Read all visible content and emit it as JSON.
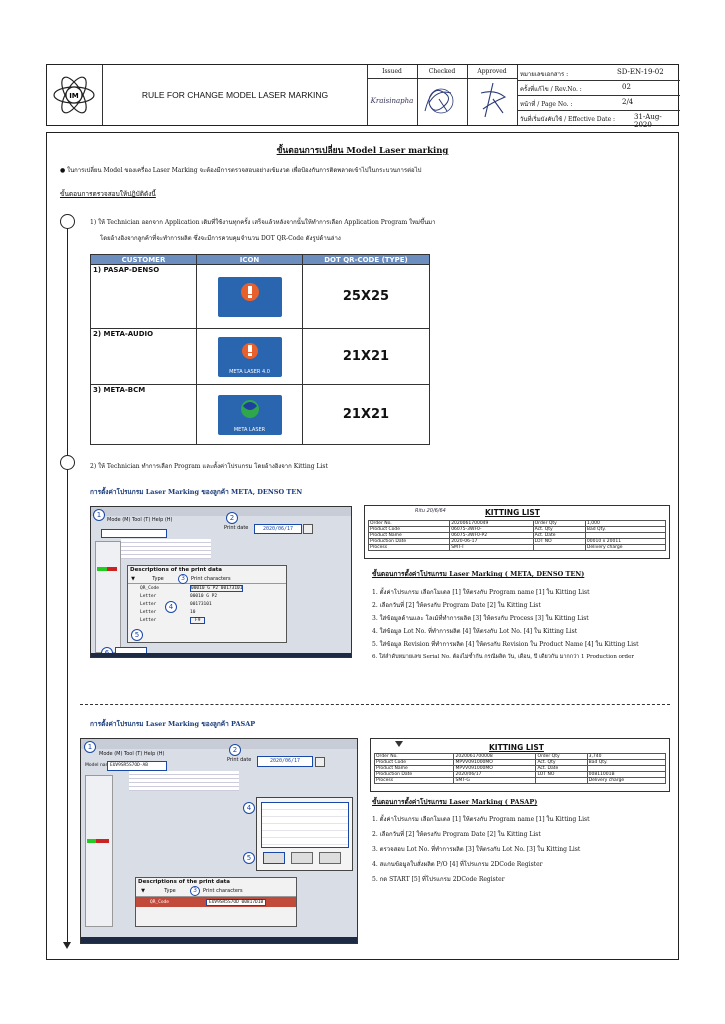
{
  "header": {
    "title": "RULE FOR CHANGE MODEL LASER MARKING",
    "issued_label": "Issued",
    "checked_label": "Checked",
    "approved_label": "Approved",
    "doc_no_label": "หมายเลขเอกสาร :",
    "doc_no": "SD-EN-19-02",
    "rev_label": "ครั้งที่แก้ไข / Rev.No. :",
    "rev": "02",
    "page_label": "หน้าที่ / Page No. :",
    "page": "2/4",
    "eff_label": "วันที่เริ่มบังคับใช้ / Effective Date :",
    "eff": "31-Aug- 2020",
    "issued_sign": "Kraisinapha",
    "logo_text": "IM"
  },
  "title": "ขั้นตอนการเปลี่ยน Model Laser marking",
  "intro": "● ในการเปลี่ยน Model ของเครื่อง Laser Marking จะต้องมีการตรวจสอบอย่างเข้มงวด เพื่อป้องกันการติดพลาดเข้าไปในกระบวนการต่อไป",
  "section1": "ขั้นตอนการตรวจสอบให้ปฏิบัติดังนี้",
  "step1_line1": "1) ให้ Technician ออกจาก Application เดิมที่ใช้งานทุกครั้ง เสร็จแล้วหลังจากนั้นให้ทำการเลือก Application Program ใหม่ขึ้นมา",
  "step1_line2": "โดยอ้างอิงจากลูกค้าที่จะทำการผลิต ซึ่งจะมีการควบคุมจำนวน DOT QR-Code ดังรูปด้านล่าง",
  "table": {
    "headers": [
      "CUSTOMER",
      "ICON",
      "DOT QR-CODE (TYPE)"
    ],
    "rows": [
      {
        "customer": "1) PASAP-DENSO",
        "icon_label": "",
        "qr": "25X25"
      },
      {
        "customer": "2) META-AUDIO",
        "icon_label": "META LASER 4.0",
        "qr": "21X21"
      },
      {
        "customer": "3) META-BCM",
        "icon_label": "META LASER",
        "qr": "21X21"
      }
    ]
  },
  "step2": "2) ให้ Technician ทำการเลือก Program และตั้งค่าโปรแกรม โดยอ้างอิงจาก Kitting List",
  "meta_section": {
    "heading": "การตั้งค่าโปรแกรม Laser Marking ของลูกค้า META, DENSO TEN",
    "ui_menu": "Mode (M)  Tool (T)  Help (H)",
    "ui_print_date_label": "Print date",
    "ui_print_date": "2020/06/17",
    "desc_title": "Descriptions of the print data",
    "type_label": "Type",
    "chars_label": "Print characters",
    "rows": [
      {
        "type": "QR_Code",
        "chars": "00010 G P2 00173101"
      },
      {
        "type": "Letter",
        "chars": "00010 G P2"
      },
      {
        "type": "Letter",
        "chars": "00173101"
      },
      {
        "type": "Letter",
        "chars": "10"
      },
      {
        "type": "Letter",
        "chars": "F9"
      }
    ],
    "kitting_title": "KITTING LIST",
    "kitting_note": "Ritu 20/6/64",
    "kit_rows": [
      [
        "Order No.",
        "2020061700049",
        "Order Qty",
        "1,000"
      ],
      [
        "Product Code",
        "06075-3WF0-",
        "Act. Qty",
        "Bad Qty."
      ],
      [
        "Product Name",
        "06075-3WF0-P2",
        "Act. Date",
        ""
      ],
      [
        "Production Date",
        "2020-06-17",
        "LOT NO",
        "00010 x 20011"
      ],
      [
        "Process",
        "SMT-T",
        "",
        "Delivery charge"
      ]
    ],
    "steps_heading": "ขั้นตอนการตั้งค่าโปรแกรม Laser Marking ( META, DENSO TEN)",
    "steps": [
      "1. ตั้งค่าโปรแกรม เลือกโมเดล [1] ให้ตรงกับ Program name [1] ใน Kitting List",
      "2. เลือกวันที่ [2] ให้ตรงกับ Program Date [2] ใน Kitting List",
      "3. ใส่ข้อมูลด้านและ โลเม้ที่ทำการผลิต [3] ให้ตรงกับ Process [3] ใน Kitting List",
      "4. ใส่ข้อมูล Lot No. ที่ทำการผลิต [4] ให้ตรงกับ Lot No. [4] ใน Kitting List",
      "5. ใส่ข้อมูล Revision ที่ทำการผลิต [4] ให้ตรงกับ Revision ใน Product Name [4] ใน Kitting List",
      "6. ใส่ลำดับหมายเลข Serial No. ต้องไม่ซ้ำกัน กรณีผลิต วัน, เดือน, ปี เดียวกัน มากกว่า 1 Production order"
    ]
  },
  "pasap_section": {
    "heading": "การตั้งค่าโปรแกรม Laser Marking ของลูกค้า PASAP",
    "ui_menu": "Mode (M)  Tool (T)  Help (H)",
    "model_label": "Model name",
    "model_value": "EUV9SR5S7OD-AB",
    "ui_print_date_label": "Print date",
    "ui_print_date": "2020/06/17",
    "desc_title": "Descriptions of the print data",
    "type_label": "Type",
    "chars_label": "Print characters",
    "row_type": "QR_Code",
    "row_chars": "EUV9SR5S7OD 00817D1B",
    "kitting_title": "KITTING LIST",
    "kit_rows": [
      [
        "Order No.",
        "2020061700008",
        "Order Qty",
        "3,740"
      ],
      [
        "Product Code",
        "MPVV091000MO",
        "Act. Qty",
        "Bad Qty."
      ],
      [
        "Product Name",
        "MPVV091000MO",
        "Act. Date",
        ""
      ],
      [
        "Production Date",
        "2020/06/17",
        "LOT NO",
        "00811001B"
      ],
      [
        "Process",
        "SMT-G",
        "",
        "Delivery charge"
      ]
    ],
    "steps_heading": "ขั้นตอนการตั้งค่าโปรแกรม Laser Marking ( PASAP)",
    "steps": [
      "1. ตั้งค่าโปรแกรม เลือกโมเดล [1] ให้ตรงกับ Program name [1] ใน Kitting List",
      "2. เลือกวันที่ [2] ให้ตรงกับ Program Date [2] ใน Kitting List",
      "3. ตรวจสอบ Lot No. ที่ทำการผลิต [3] ให้ตรงกับ Lot No. [3] ใน Kitting List",
      "4. สแกนข้อมูลใบสั่งผลิต P/O [4] ที่โปรแกรม 2DCode Register",
      "5. กด START [5] ที่โปรแกรม 2DCode Register"
    ]
  },
  "colors": {
    "table_header": "#6c8ebf",
    "blue_marker": "#1a48a8",
    "icon_bg": "#1e5fa8"
  }
}
